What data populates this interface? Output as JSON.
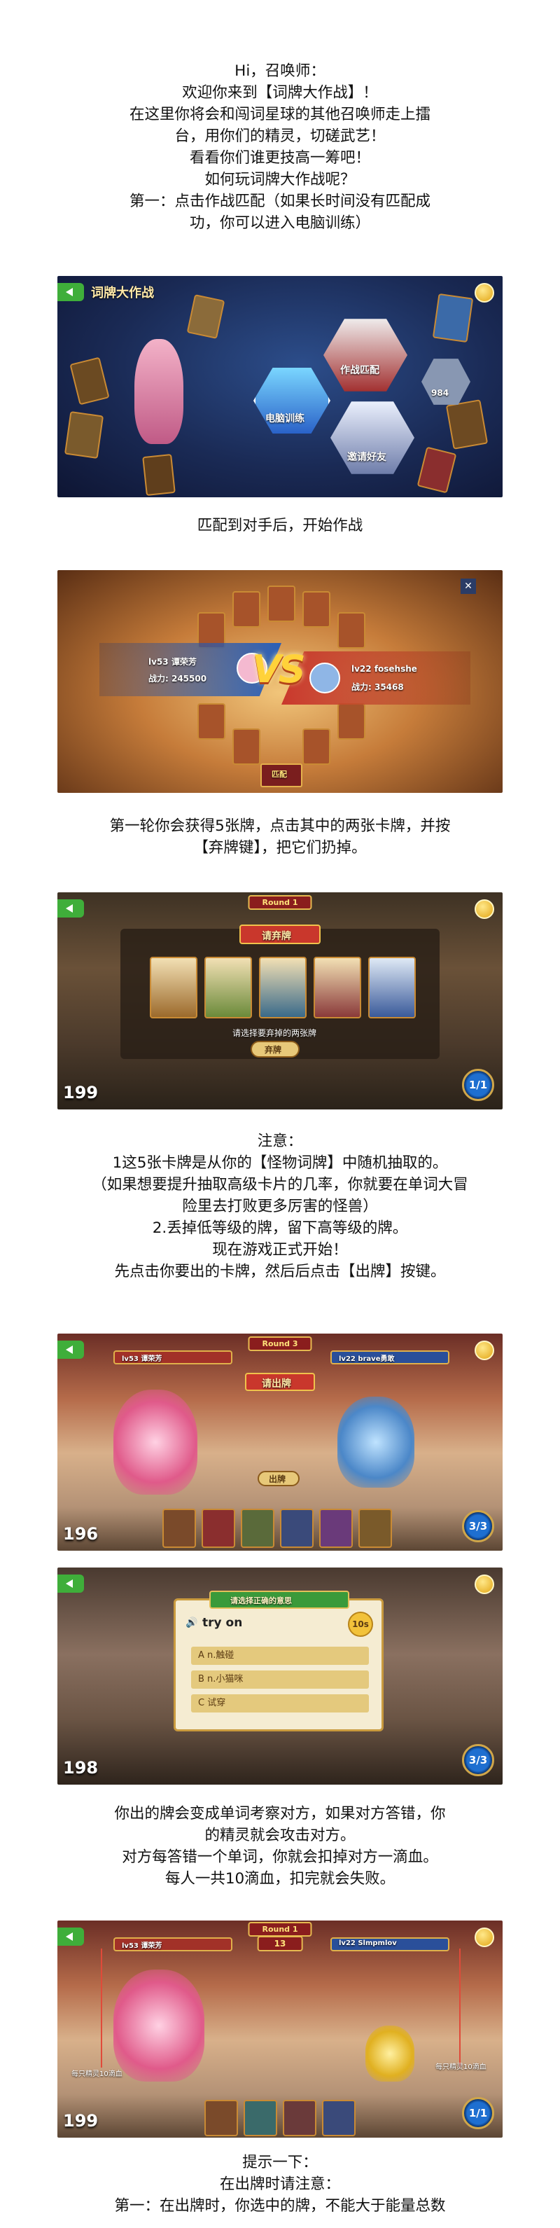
{
  "intro": {
    "lines": [
      "Hi，召唤师：",
      "欢迎你来到【词牌大作战】！",
      "在这里你将会和闯词星球的其他召唤师走上擂",
      "台，用你们的精灵，切磋武艺！",
      "看看你们谁更技高一筹吧！",
      "如何玩词牌大作战呢？",
      "第一：点击作战匹配（如果长时间没有匹配成",
      "功，你可以进入电脑训练）"
    ]
  },
  "screen1": {
    "title": "词牌大作战",
    "hex_labels": [
      "电脑训练",
      "作战匹配",
      "邀请好友"
    ],
    "counter": "984"
  },
  "caption1": "匹配到对手后，开始作战",
  "screen2": {
    "left_player": "lv53 谭荣芳",
    "left_power": "战力: 245500",
    "vs": "VS",
    "right_player": "lv22 fosehshe",
    "right_power": "战力: 35468",
    "bottom_tag": "匹配"
  },
  "caption2": {
    "lines": [
      "第一轮你会获得5张牌，点击其中的两张卡牌，并按",
      "【弃牌键】，把它们扔掉。"
    ]
  },
  "screen3": {
    "round": "Round 1",
    "banner": "请弃牌",
    "prompt": "请选择要弃掉的两张牌",
    "discard": "弃牌",
    "left_num": "199",
    "energy": "1/1"
  },
  "notes": {
    "lines": [
      "注意：",
      "1这5张卡牌是从你的【怪物词牌】中随机抽取的。",
      "（如果想要提升抽取高级卡片的几率，你就要在单词大冒",
      "险里去打败更多厉害的怪兽）",
      "2.丢掉低等级的牌，留下高等级的牌。",
      "现在游戏正式开始！",
      "先点击你要出的卡牌，然后后点击【出牌】按键。"
    ]
  },
  "screen4": {
    "round": "Round 3",
    "banner": "请出牌",
    "play": "出牌",
    "left_num": "196",
    "energy": "3/3",
    "left_player": "lv53 谭荣芳",
    "right_player": "lv22 brave勇敢"
  },
  "screen5": {
    "banner": "请选择正确的意思",
    "word": "try on",
    "timer": "10s",
    "options": [
      "A  n.触碰",
      "B  n.小猫咪",
      "C  试穿"
    ],
    "left_num": "198",
    "energy": "3/3"
  },
  "caption5": {
    "lines": [
      "你出的牌会变成单词考察对方，如果对方答错，你",
      "的精灵就会攻击对方。",
      "对方每答错一个单词，你就会扣掉对方一滴血。",
      "每人一共10滴血，扣完就会失败。"
    ]
  },
  "screen6": {
    "round": "Round 1",
    "turn": "13",
    "left_player": "lv53 谭荣芳",
    "right_player": "lv22 Slmpmlov",
    "left_num": "199",
    "energy": "1/1",
    "left_note": "每只精灵10滴血",
    "right_note": "每只精灵10滴血"
  },
  "tips": {
    "lines": [
      "提示一下：",
      "在出牌时请注意：",
      "第一：在出牌时，你选中的牌，不能大于能量总数"
    ]
  },
  "colors": {
    "green_button": "#3fae3a",
    "gold": "#e2a514",
    "battle_red": "#c9372c",
    "battle_blue": "#2a5fb8"
  }
}
